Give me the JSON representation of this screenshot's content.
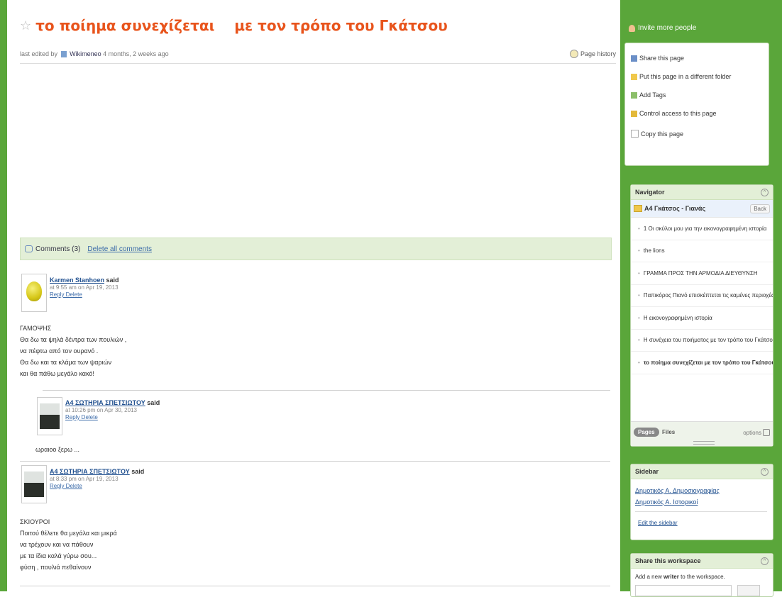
{
  "page": {
    "title": "το ποίημα συνεχίζεται    με τον τρόπο του Γκάτσου",
    "meta_prefix": "last edited by",
    "meta_user": "Wikimeneo",
    "meta_suffix": "4 months, 2 weeks ago",
    "page_history": "Page history"
  },
  "comments_bar": {
    "label": "Comments (3)",
    "delete_all": "Delete all comments"
  },
  "comments": [
    {
      "author": "Karmen Stanhoen",
      "said": "said",
      "time": "at 9:55 am on Apr 19, 2013",
      "actions": "Reply Delete",
      "body": [
        "ΓΑΜΟΨΗΣ",
        "Θα δω τα ψηλά δέντρα των πουλιών ,",
        "να πέφτω από τον ουρανό .",
        "Θα δω και τα κλάμα των ψαριών",
        "και θα πάθω μεγάλο κακό!"
      ]
    },
    {
      "author": "Α4 ΣΩΤΗΡΙΑ ΣΠΕΤΣΙΩΤΟΥ",
      "said": "said",
      "time": "at 10:26 pm on Apr 30, 2013",
      "actions": "Reply Delete",
      "body": [
        "ωραιοο ξερω ..."
      ]
    },
    {
      "author": "Α4 ΣΩΤΗΡΙΑ ΣΠΕΤΣΙΩΤΟΥ",
      "said": "said",
      "time": "at 8:33 pm on Apr 19, 2013",
      "actions": "Reply Delete",
      "body": [
        "ΣΚΙΟΥΡΟΙ",
        "Ποιτού θέλετε θα μεγάλα και μικρά",
        "να τρέχουν και να πάθουν",
        "με τα ίδια καλά γύρω σου...",
        "φύση , πουλιά πεθαίνουν"
      ]
    }
  ],
  "right": {
    "invite": "Invite more people",
    "actions": [
      "Share this page",
      "Put this page in a different folder",
      "Add Tags",
      "Control access to this page",
      "Copy this page"
    ]
  },
  "navigator": {
    "title": "Navigator",
    "current": "Α4 Γκάτσος - Γιανάς",
    "back": "Back",
    "items": [
      "1 Οι σκύλοι μου για την εικονογραφημένη ιστορία",
      "the lions",
      "ΓΡΑΜΜΑ ΠΡΟΣ ΤΗΝ ΑΡΜΟΔΙΑ ΔΙΕΥΘΥΝΣΗ",
      "Παπικόρος Πιανό επισκέπτεται τις καμένες περιοχές",
      "Η εικονογραφημένη ιστορία",
      "Η συνέχεια του ποιήματος με τον τρόπο του Γκάτσου",
      "το ποίημα συνεχίζεται με τον τρόπο του Γκάτσου"
    ],
    "tab_pages": "Pages",
    "tab_files": "Files",
    "options": "options"
  },
  "sidebar": {
    "title": "Sidebar",
    "links": [
      "Δημοτικός Α. Δημοσιογραφίας",
      "Δημοτικός Α. Ιστορικοί"
    ],
    "edit": "Edit the sidebar"
  },
  "share_workspace": {
    "title": "Share this workspace",
    "text_prefix": "Add a new",
    "text_bold": "writer",
    "text_suffix": "to the workspace."
  }
}
